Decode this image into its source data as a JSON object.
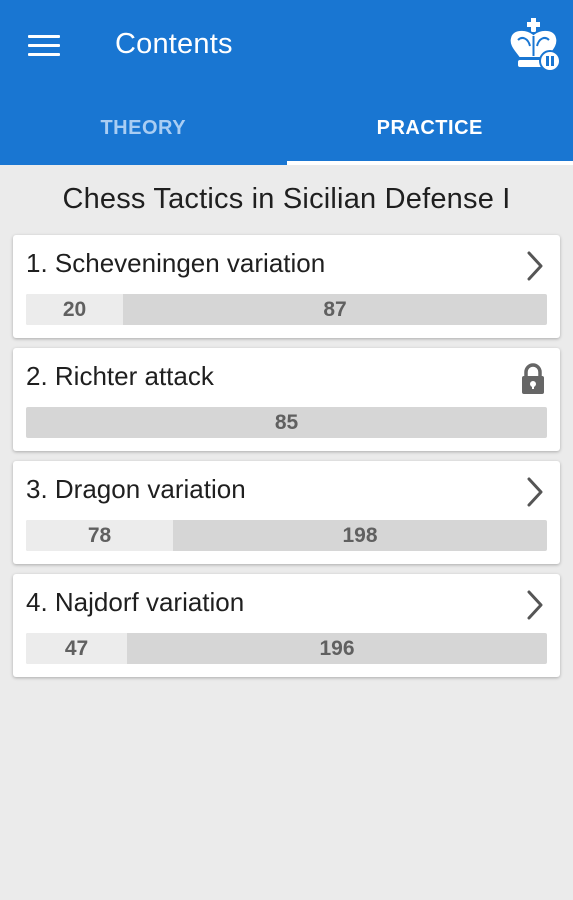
{
  "appbar": {
    "title": "Contents",
    "menu_icon": "menu-icon",
    "logo_icon": "chess-king-logo-icon",
    "color": "#1976d2"
  },
  "tabs": [
    {
      "label": "THEORY",
      "active": false
    },
    {
      "label": "PRACTICE",
      "active": true
    }
  ],
  "book_title": "Chess Tactics in Sicilian Defense I",
  "chapters": [
    {
      "label": "1. Scheveningen variation",
      "solved": "20",
      "total": "87",
      "locked": false,
      "solved_fraction": 0.19
    },
    {
      "label": "2. Richter attack",
      "solved": "",
      "total": "85",
      "locked": true,
      "solved_fraction": 0
    },
    {
      "label": "3. Dragon variation",
      "solved": "78",
      "total": "198",
      "locked": false,
      "solved_fraction": 0.28
    },
    {
      "label": "4. Najdorf variation",
      "solved": "47",
      "total": "196",
      "locked": false,
      "solved_fraction": 0.195
    }
  ]
}
